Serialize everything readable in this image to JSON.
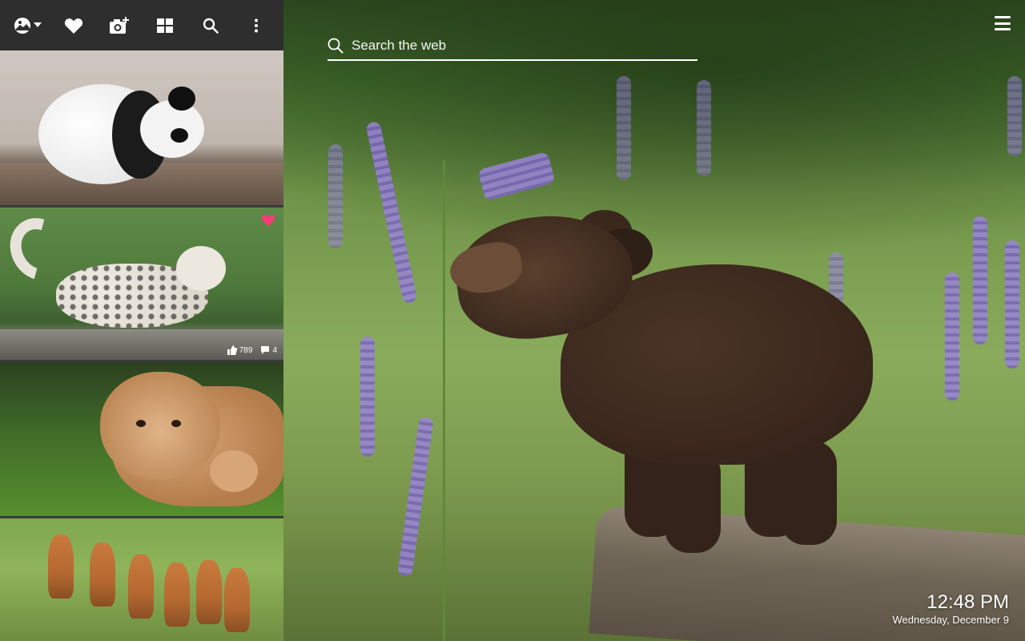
{
  "toolbar": {
    "items": [
      {
        "name": "wallpaper-menu",
        "icon": "image-dropdown-icon"
      },
      {
        "name": "favorites",
        "icon": "heart-icon"
      },
      {
        "name": "add-photo",
        "icon": "camera-plus-icon"
      },
      {
        "name": "gallery",
        "icon": "grid-icon"
      },
      {
        "name": "search",
        "icon": "search-icon"
      },
      {
        "name": "more",
        "icon": "more-vertical-icon"
      }
    ]
  },
  "gallery": {
    "tiles": [
      {
        "subject": "panda cub",
        "favorited": false
      },
      {
        "subject": "snow leopard cub",
        "favorited": true,
        "likes": "789",
        "comments": "4"
      },
      {
        "subject": "lion cub",
        "favorited": false
      },
      {
        "subject": "fox cubs",
        "favorited": false
      }
    ]
  },
  "search": {
    "placeholder": "Search the web"
  },
  "menu": {
    "icon": "hamburger-menu-icon"
  },
  "clock": {
    "time": "12:48 PM",
    "date": "Wednesday, December 9"
  },
  "colors": {
    "toolbar_bg": "#2e2e2e",
    "heart_accent": "#ff3b7a",
    "text": "#ffffff"
  }
}
